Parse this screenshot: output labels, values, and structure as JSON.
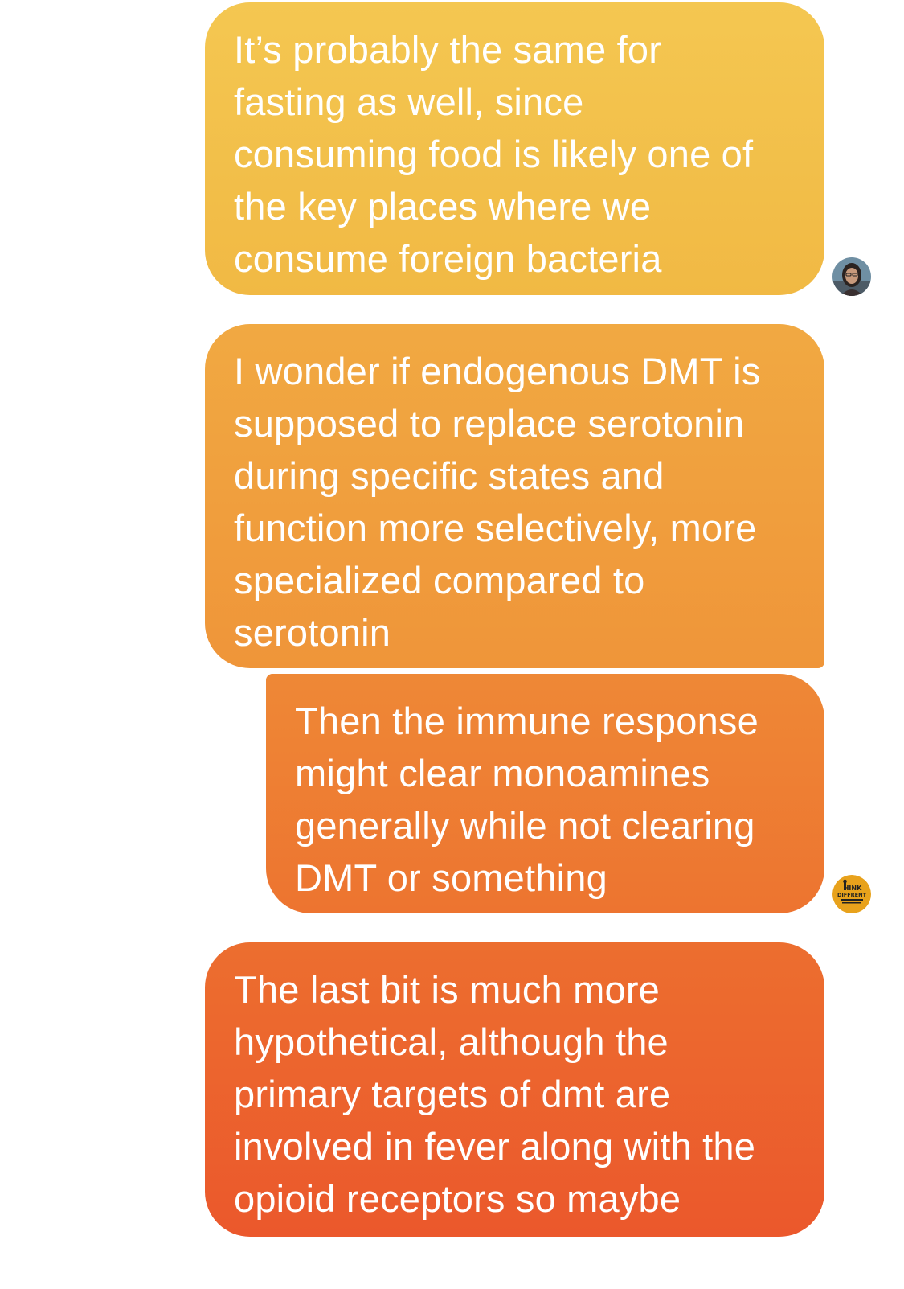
{
  "messages": [
    {
      "text": "It’s probably the same for\nfasting as well, since\nconsuming food is likely one of\nthe key places where we\nconsume foreign bacteria",
      "sender": "person-photo"
    },
    {
      "text": "I wonder if endogenous DMT is\nsupposed to replace serotonin\nduring specific states and\nfunction more selectively, more\nspecialized compared to\nserotonin",
      "sender": "self"
    },
    {
      "text": "Then the immune response\nmight clear monoamines\ngenerally while not clearing\nDMT or something",
      "sender": "think-different"
    },
    {
      "text": "The last bit is much more\nhypothetical, although the\nprimary targets of dmt are\ninvolved in fever along with the\nopioid receptors so maybe",
      "sender": "self"
    }
  ],
  "avatars": {
    "first": {
      "icon": "person-photo-avatar"
    },
    "second": {
      "icon": "think-different-logo-avatar",
      "text": "THINK DIFFRENT"
    }
  },
  "colors": {
    "bubble1_top": "#f4c751",
    "bubble4_bottom": "#eb582c",
    "text": "#ffffff",
    "background": "#ffffff"
  }
}
